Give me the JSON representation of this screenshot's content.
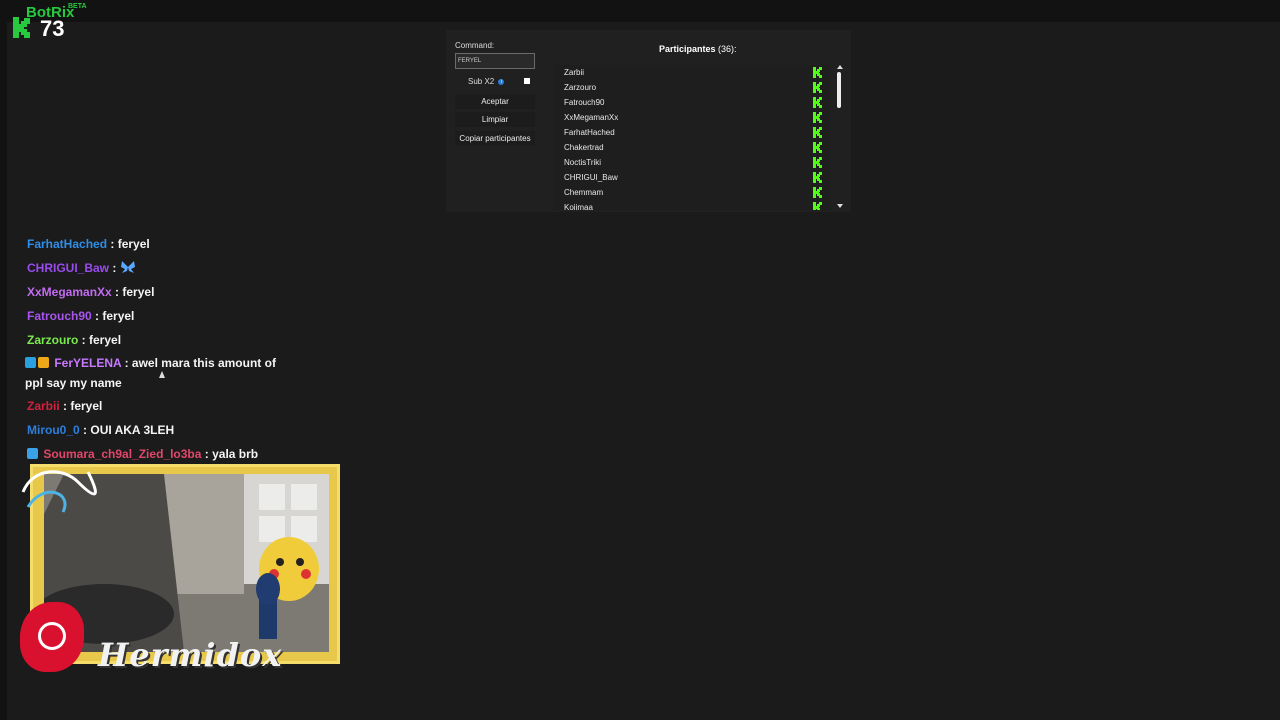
{
  "overlay": {
    "brand": "BotRix",
    "brand_tag": "BETA",
    "viewer_count": "73",
    "logo_icon": "kick-logo-icon"
  },
  "panel": {
    "command_label": "Command:",
    "command_value": "FERYEL",
    "sub_label": "Sub X2",
    "sub_icon": "info-icon",
    "buttons": {
      "accept": "Aceptar",
      "clear": "Limpiar",
      "copy": "Copiar participantes"
    },
    "participants_label": "Participantes",
    "participants_count": "(36):",
    "participants": [
      "Zarbii",
      "Zarzouro",
      "Fatrouch90",
      "XxMegamanXx",
      "FarhatHached",
      "Chakertrad",
      "NoctisTriki",
      "CHRIGUI_Baw",
      "Chemmam",
      "Kojimaa"
    ],
    "platform_icon": "kick-k-icon",
    "accent": "#53fc18"
  },
  "chat": {
    "messages": [
      {
        "user": "FarhatHached",
        "sep": " : ",
        "text": "feryel",
        "color": "#2f8ee8"
      },
      {
        "user": "CHRIGUI_Baw",
        "sep": " : ",
        "text": "",
        "color": "#9a4bf0",
        "emote": "butterfly-emote-icon"
      },
      {
        "user": "XxMegamanXx",
        "sep": " : ",
        "text": "feryel",
        "color": "#c36cf2"
      },
      {
        "user": "Fatrouch90",
        "sep": " : ",
        "text": "feryel",
        "color": "#a855ef"
      },
      {
        "user": "Zarzouro",
        "sep": " : ",
        "text": "feryel",
        "color": "#7bea4f"
      },
      {
        "user": "FerYELENA",
        "sep": " : ",
        "text": "awel mara this amount of ppl say my name",
        "color": "#c779ff",
        "badges": [
          "sub-badge-icon",
          "crown-badge-icon"
        ]
      },
      {
        "user": "Zarbii",
        "sep": " : ",
        "text": "feryel",
        "color": "#d3223d"
      },
      {
        "user": "Mirou0_0",
        "sep": " : ",
        "text": "OUI AKA 3LEH",
        "color": "#2d7fdc"
      },
      {
        "user": "Soumara_ch9al_Zied_lo3ba",
        "sep": " : ",
        "text": "yala brb",
        "color": "#e2476b",
        "badges": [
          "gem-badge-icon"
        ]
      }
    ]
  },
  "webcam": {
    "streamer": "Hermidox",
    "frame_color": "#e8c84a"
  }
}
